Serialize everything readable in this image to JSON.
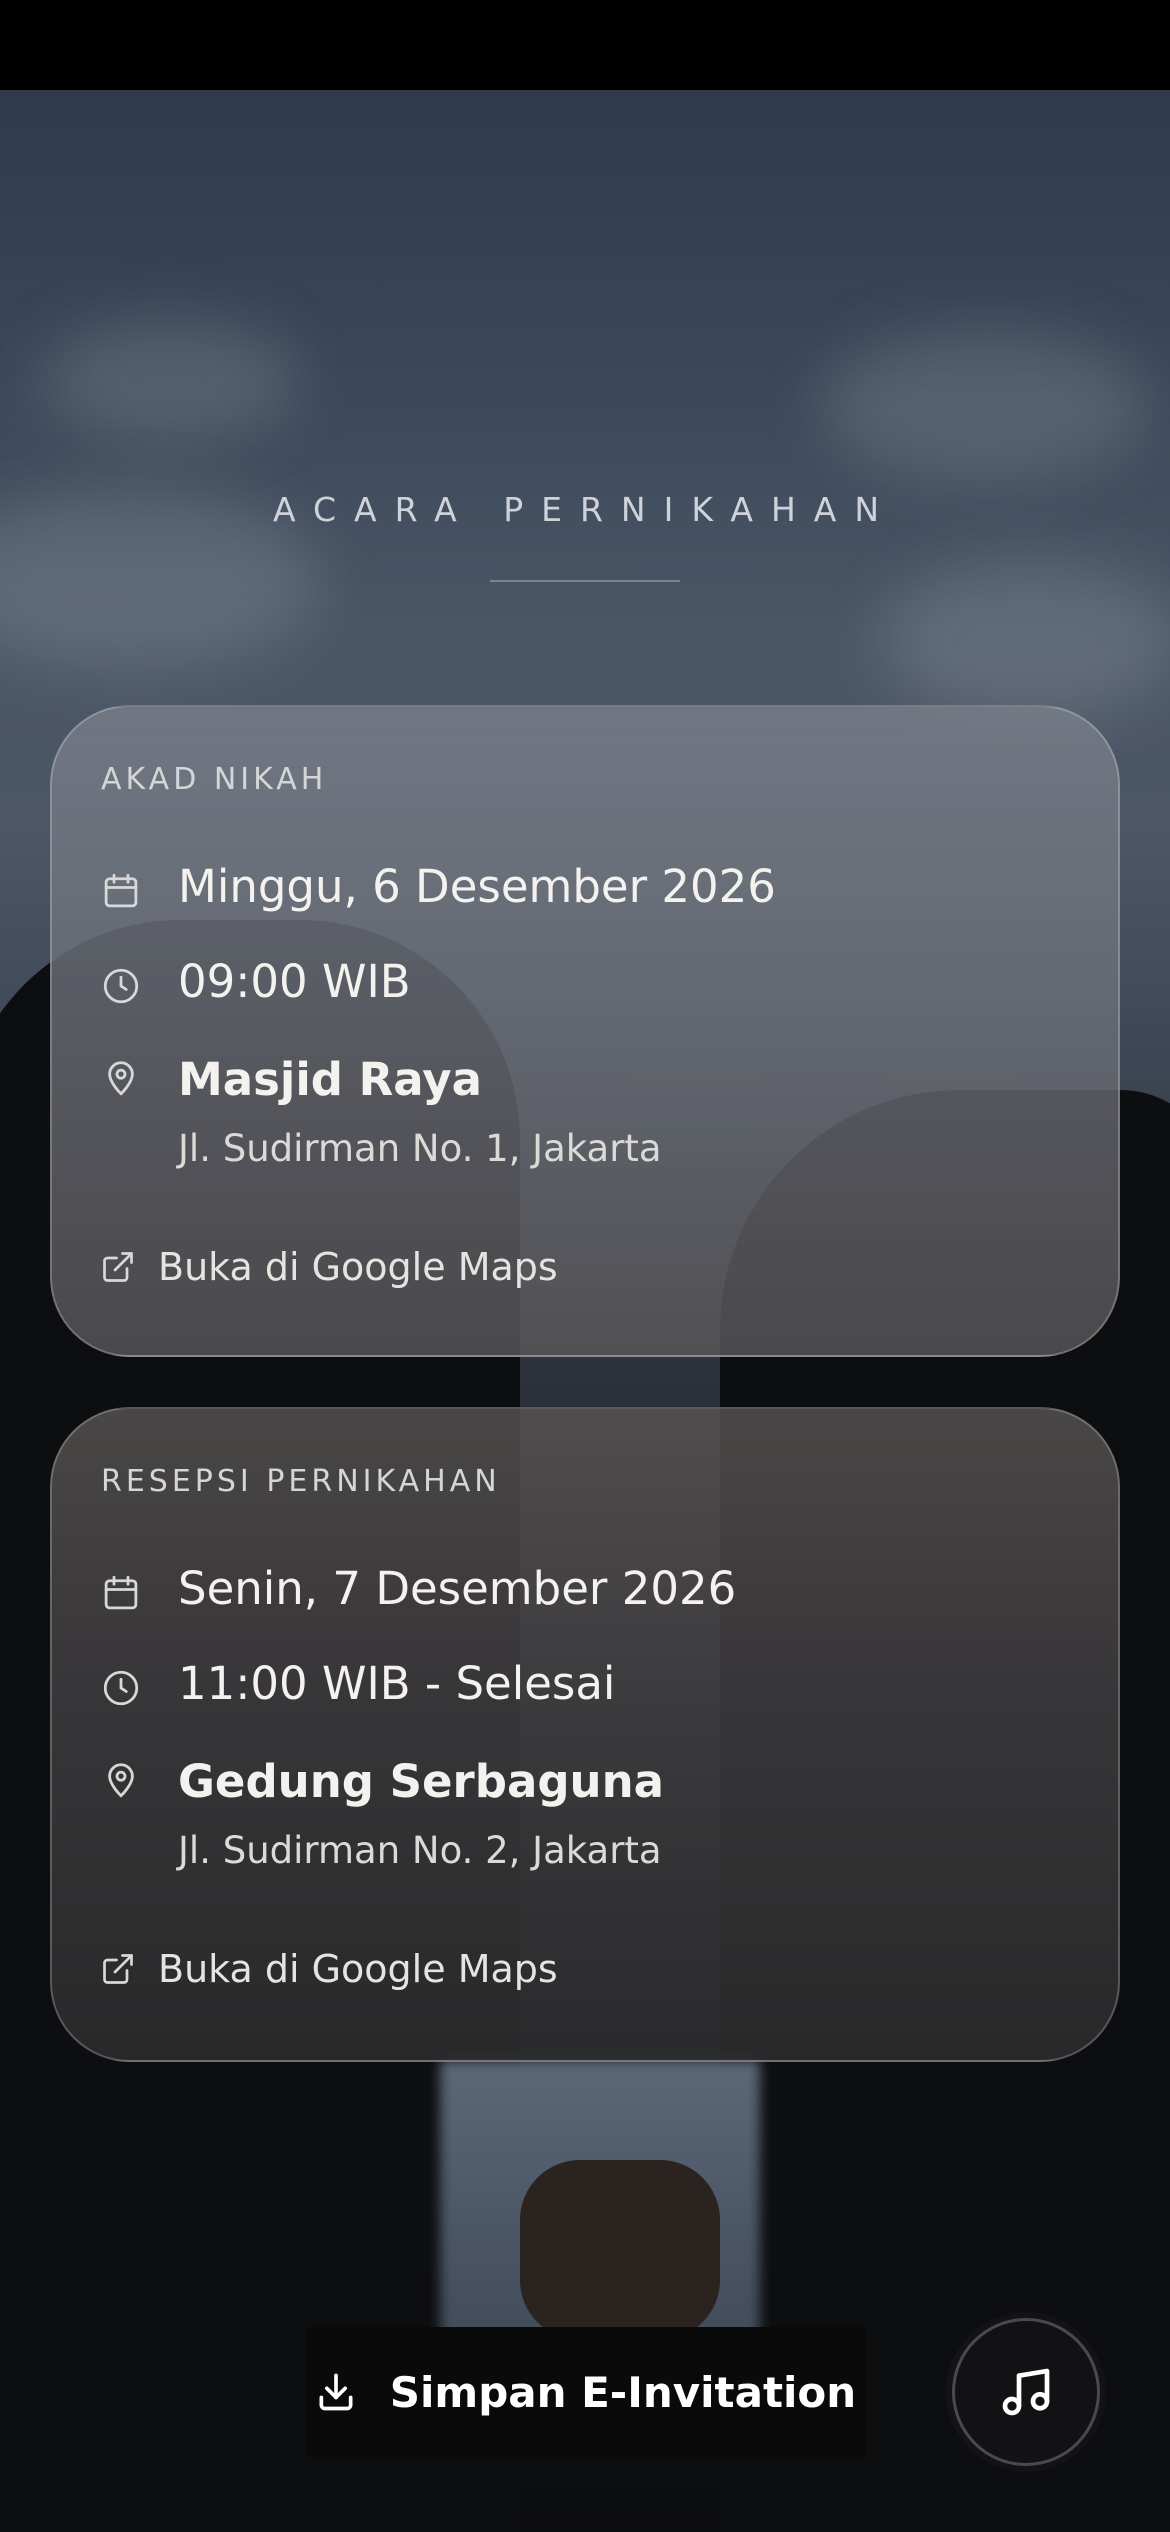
{
  "section": {
    "title": "ACARA PERNIKAHAN"
  },
  "events": [
    {
      "label": "AKAD NIKAH",
      "date": "Minggu, 6 Desember 2026",
      "time": "09:00 WIB",
      "venue": "Masjid Raya",
      "address": "Jl. Sudirman No. 1, Jakarta",
      "maps_label": "Buka di Google Maps"
    },
    {
      "label": "RESEPSI PERNIKAHAN",
      "date": "Senin, 7 Desember 2026",
      "time": "11:00 WIB - Selesai",
      "venue": "Gedung Serbaguna",
      "address": "Jl. Sudirman No. 2, Jakarta",
      "maps_label": "Buka di Google Maps"
    }
  ],
  "actions": {
    "save_label": "Simpan E-Invitation"
  },
  "icons": {
    "date": "calendar-icon",
    "time": "clock-icon",
    "location": "map-pin-icon",
    "link": "external-link-icon",
    "download": "download-icon",
    "music": "music-note-icon"
  }
}
